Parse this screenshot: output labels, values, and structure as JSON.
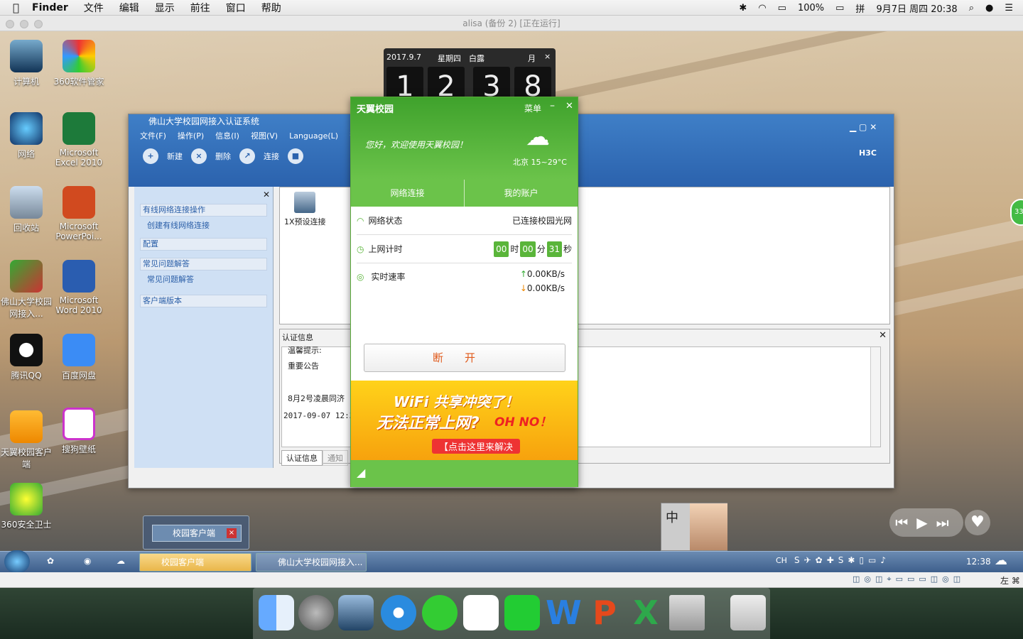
{
  "menubar": {
    "app": "Finder",
    "items": [
      "文件",
      "编辑",
      "显示",
      "前往",
      "窗口",
      "帮助"
    ],
    "battery": "100%",
    "ime": "拼",
    "datetime": "9月7日 周四  20:38"
  },
  "vm": {
    "title": "alisa (备份 2) [正在运行]"
  },
  "desktop_icons": [
    {
      "label": "计算机"
    },
    {
      "label": "360软件管家"
    },
    {
      "label": "网络"
    },
    {
      "label": "Microsoft Excel 2010"
    },
    {
      "label": "回收站"
    },
    {
      "label": "Microsoft PowerPoi..."
    },
    {
      "label": "佛山大学校园网接入..."
    },
    {
      "label": "Microsoft Word 2010"
    },
    {
      "label": "腾讯QQ"
    },
    {
      "label": "百度网盘"
    },
    {
      "label": "天翼校园客户端"
    },
    {
      "label": "搜狗壁纸"
    },
    {
      "label": "360安全卫士"
    }
  ],
  "clock": {
    "date": "2017.9.7",
    "weekday": "星期四",
    "term": "白露",
    "mode": "月",
    "d1": "1",
    "d2": "2",
    "d3": "3",
    "d4": "8"
  },
  "h3c": {
    "title": "佛山大学校园网接入认证系统",
    "menu": [
      "文件(F)",
      "操作(P)",
      "信息(I)",
      "视图(V)",
      "Language(L)",
      "帮"
    ],
    "tools": {
      "new": "新建",
      "delete": "删除",
      "connect": "连接"
    },
    "brand": "H3C",
    "sidebar": {
      "wired": "有线网络连接操作",
      "create": "创建有线网络连接",
      "config": "配置",
      "faq": "常见问题解答",
      "faq_item": "常见问题解答",
      "version": "客户端版本"
    },
    "connection": "1X预设连接",
    "info_title": "认证信息",
    "notice": {
      "line1": "温馨提示:",
      "line2": "重要公告",
      "line3": "8月2号凌晨同济",
      "line4": "2017-09-07 12:37"
    },
    "tabs": [
      "认证信息",
      "通知"
    ]
  },
  "tianyi": {
    "logo": "天翼校园",
    "menu": "菜单",
    "welcome": "您好，欢迎使用天翼校园！",
    "weather": "北京 15~29°C",
    "tab_net": "网络连接",
    "tab_account": "我的账户",
    "status_label": "网络状态",
    "status_value": "已连接校园光网",
    "time_label": "上网计时",
    "hh": "00",
    "h_unit": "时",
    "mm": "00",
    "m_unit": "分",
    "ss": "31",
    "s_unit": "秒",
    "speed_label": "实时速率",
    "up": "0.00KB/s",
    "down": "0.00KB/s",
    "disconnect": "断开",
    "ad": {
      "line1": "WiFi 共享冲突了！",
      "line2": "无法正常上网?",
      "oh": "OH NO！",
      "cta": "【点击这里来解决"
    }
  },
  "popup": {
    "label": "校园客户端"
  },
  "taskbar": {
    "item1": "校园客户端",
    "item2": "佛山大学校园网接入...",
    "lang": "CH",
    "time": "12:38",
    "zh": "中"
  },
  "tray2": {
    "text": "左 ⌘"
  },
  "side_badge": "33"
}
